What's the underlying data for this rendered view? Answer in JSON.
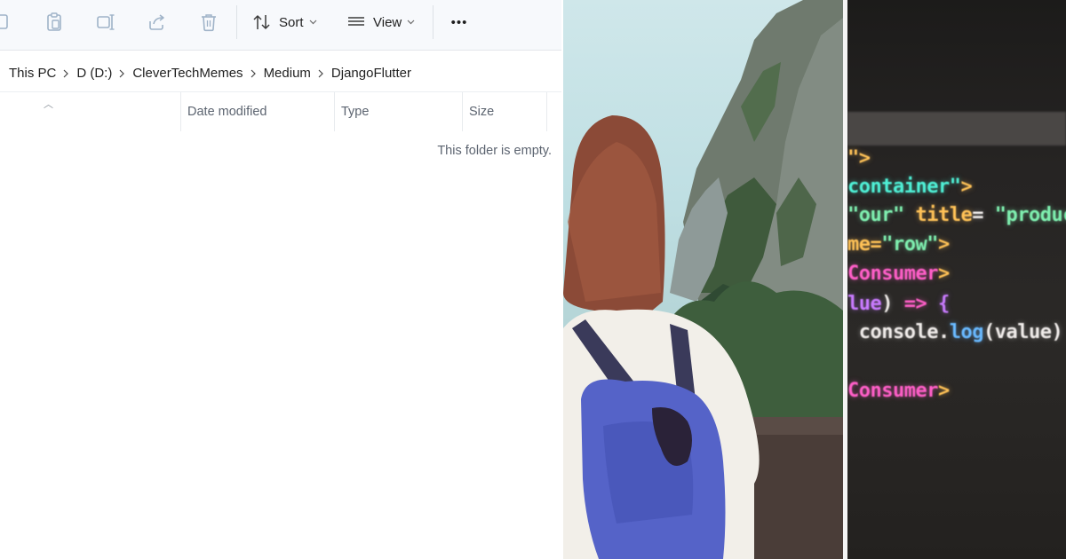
{
  "toolbar": {
    "sort_label": "Sort",
    "view_label": "View",
    "more_label": "•••"
  },
  "breadcrumb": [
    "This PC",
    "D (D:)",
    "CleverTechMemes",
    "Medium",
    "DjangoFlutter"
  ],
  "columns": [
    "Date modified",
    "Type",
    "Size"
  ],
  "empty_message": "This folder is empty.",
  "code_lines": [
    {
      "parts": [
        {
          "t": "\">",
          "c": "c-orange"
        }
      ]
    },
    {
      "parts": [
        {
          "t": "container\"",
          "c": "c-cyan"
        },
        {
          "t": ">",
          "c": "c-orange"
        }
      ]
    },
    {
      "parts": [
        {
          "t": "\"our\"",
          "c": "c-green"
        },
        {
          "t": " title",
          "c": "c-orange"
        },
        {
          "t": "= ",
          "c": "c-white"
        },
        {
          "t": "\"product",
          "c": "c-green"
        }
      ]
    },
    {
      "parts": [
        {
          "t": "me=",
          "c": "c-orange"
        },
        {
          "t": "\"row\"",
          "c": "c-green"
        },
        {
          "t": ">",
          "c": "c-orange"
        }
      ]
    },
    {
      "parts": [
        {
          "t": "Consumer",
          "c": "c-pink"
        },
        {
          "t": ">",
          "c": "c-orange"
        }
      ]
    },
    {
      "parts": [
        {
          "t": "lue",
          "c": "c-violet"
        },
        {
          "t": ") ",
          "c": "c-white"
        },
        {
          "t": "=> ",
          "c": "c-pink"
        },
        {
          "t": "{",
          "c": "c-violet"
        }
      ]
    },
    {
      "parts": [
        {
          "t": " console",
          "c": "c-white"
        },
        {
          "t": ".",
          "c": "c-white"
        },
        {
          "t": "log",
          "c": "c-blue"
        },
        {
          "t": "(value)",
          "c": "c-white"
        }
      ]
    },
    {
      "parts": [
        {
          "t": "",
          "c": "c-white"
        }
      ]
    },
    {
      "parts": [
        {
          "t": "Consumer",
          "c": "c-pink"
        },
        {
          "t": ">",
          "c": "c-orange"
        }
      ]
    }
  ]
}
